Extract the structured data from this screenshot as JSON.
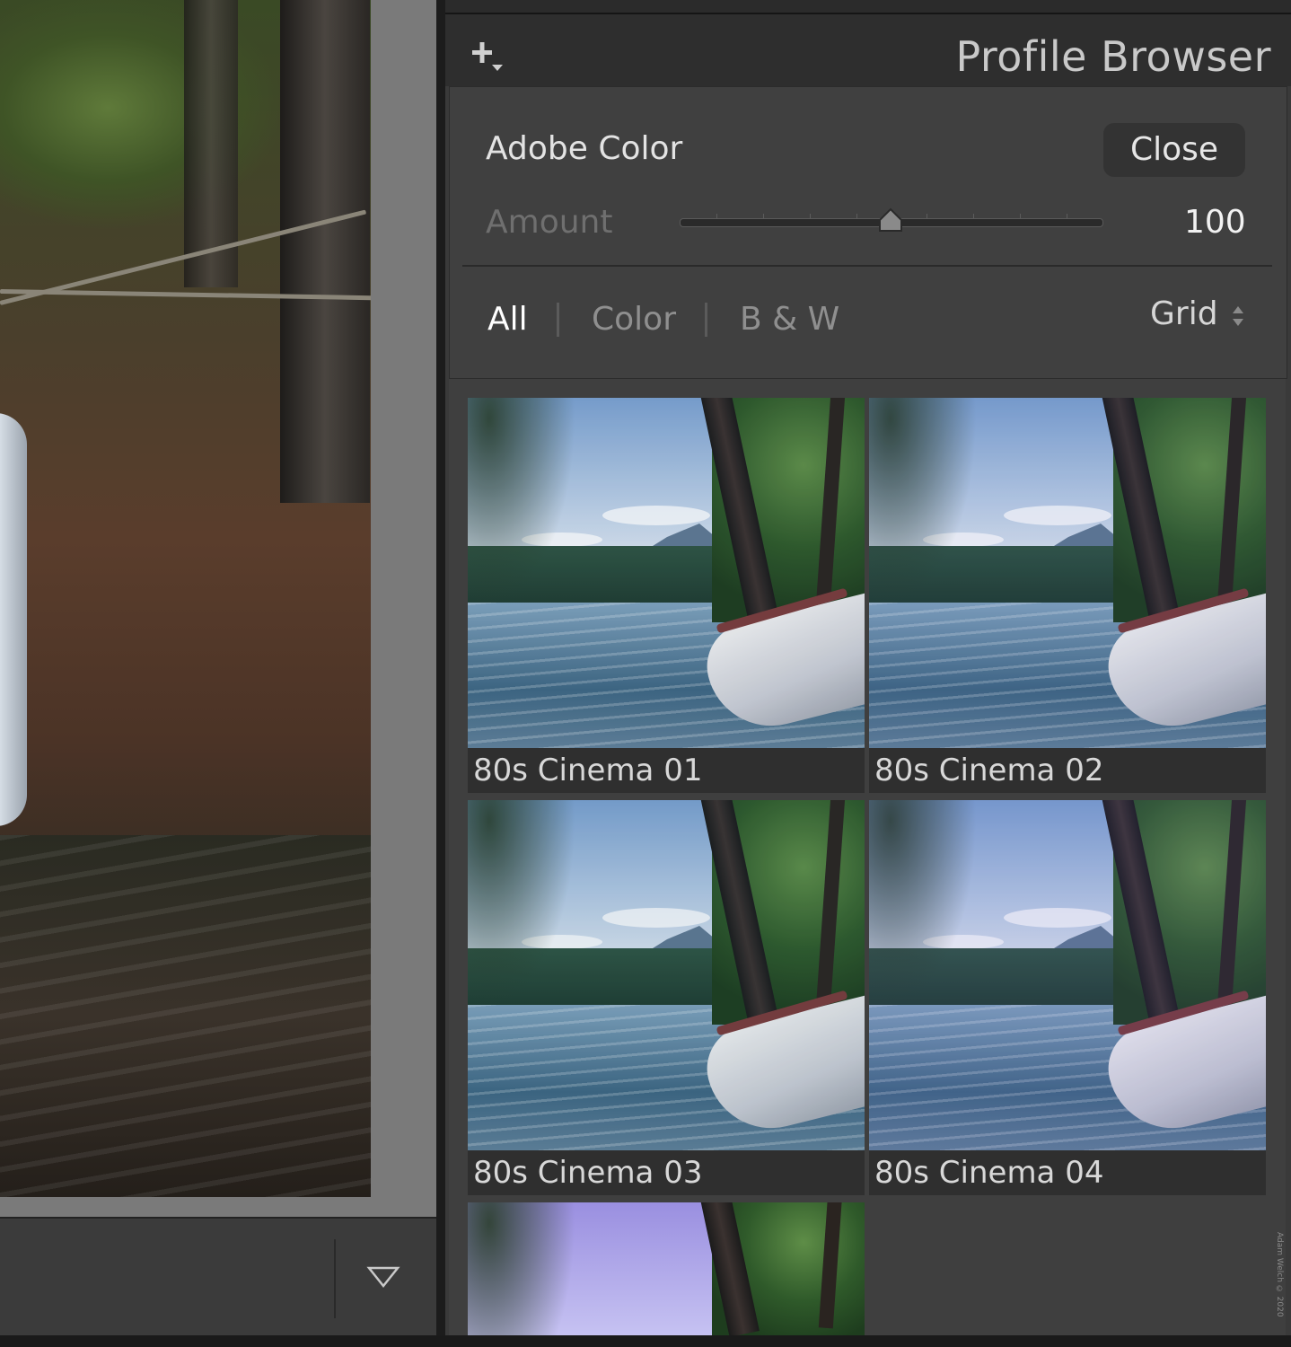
{
  "panel": {
    "title": "Profile Browser",
    "current_profile": "Adobe Color",
    "close_label": "Close",
    "amount_label": "Amount",
    "amount_value": "100",
    "amount": 50
  },
  "filters": {
    "tabs": [
      {
        "label": "All",
        "active": true
      },
      {
        "label": "Color",
        "active": false
      },
      {
        "label": "B & W",
        "active": false
      }
    ],
    "view_mode": "Grid"
  },
  "profiles": [
    {
      "name": "80s Cinema 01"
    },
    {
      "name": "80s Cinema 02"
    },
    {
      "name": "80s Cinema 03"
    },
    {
      "name": "80s Cinema 04"
    }
  ],
  "watermark": "Adam Welch © 2020",
  "colors": {
    "panel_bg": "#3a3a3a",
    "header_bg": "#2e2e2e",
    "active_text": "#ffffff",
    "inactive_text": "#8f8f8f"
  }
}
